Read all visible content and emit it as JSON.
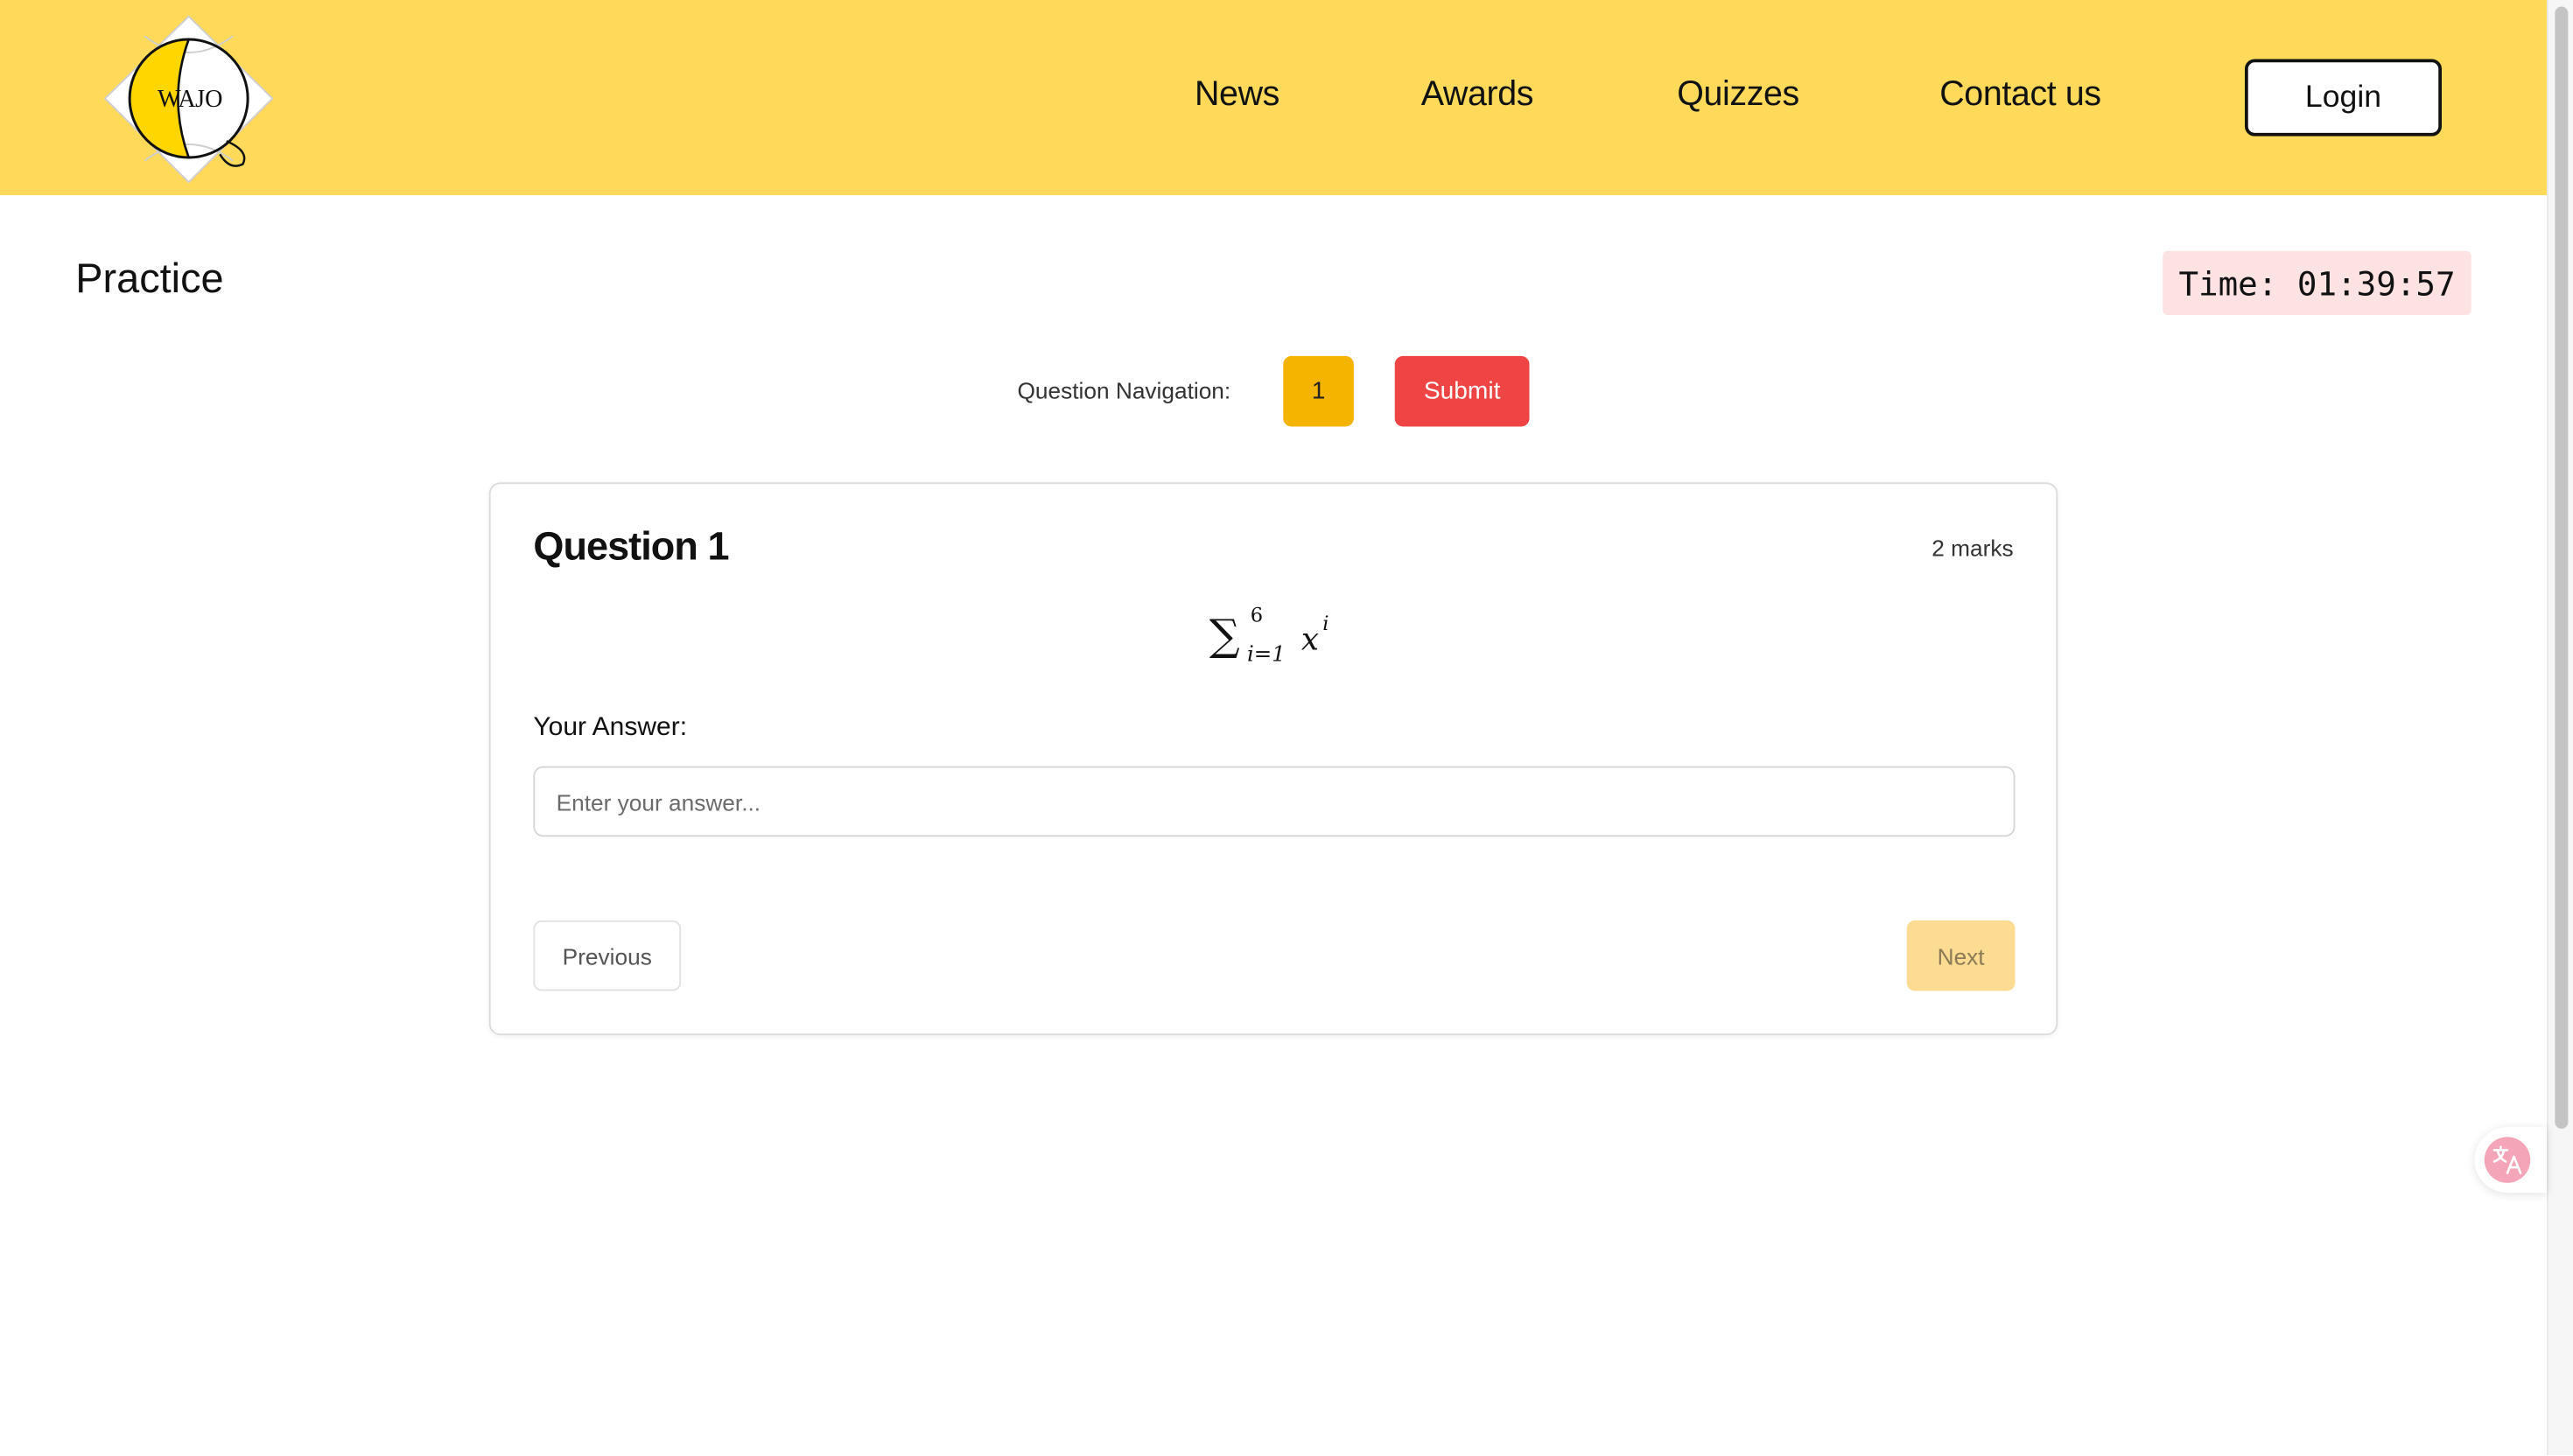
{
  "header": {
    "logo": {
      "text_left": "WA",
      "text_right": "JO",
      "accent": "#FFD600"
    },
    "nav": [
      {
        "label": "News"
      },
      {
        "label": "Awards"
      },
      {
        "label": "Quizzes"
      },
      {
        "label": "Contact us"
      }
    ],
    "login_label": "Login",
    "background": "#FFD95A"
  },
  "page": {
    "title": "Practice",
    "timer": "Time: 01:39:57"
  },
  "question_nav": {
    "label": "Question Navigation:",
    "buttons": [
      "1"
    ],
    "submit_label": "Submit"
  },
  "question": {
    "title": "Question 1",
    "marks": "2 marks",
    "formula": {
      "operator": "∑",
      "upper": "6",
      "lower": "i=1",
      "base": "x",
      "exponent": "i"
    },
    "answer_label": "Your Answer:",
    "answer_value": "",
    "answer_placeholder": "Enter your answer...",
    "previous_label": "Previous",
    "next_label": "Next"
  },
  "widgets": {
    "translate_icon": "translate-icon"
  },
  "colors": {
    "current_question": "#F5B400",
    "submit": "#EF4444",
    "next_disabled": "#FCDB92",
    "timer_bg": "#FDE2E2"
  }
}
